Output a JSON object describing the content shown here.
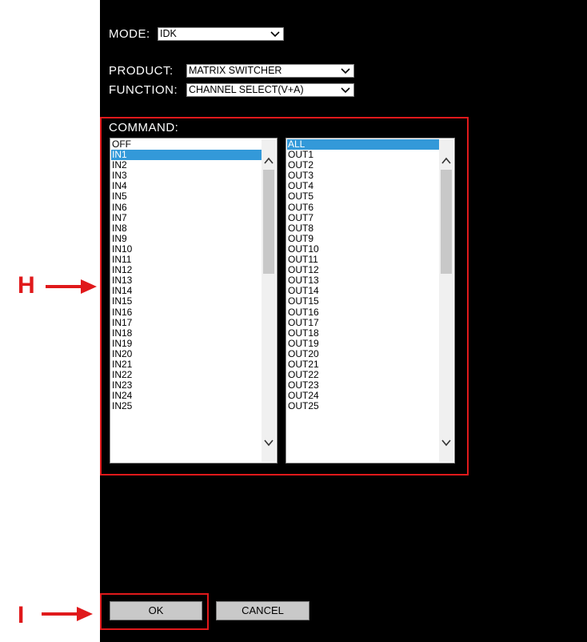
{
  "mode": {
    "label": "MODE:",
    "value": "IDK"
  },
  "product": {
    "label": "PRODUCT:",
    "value": "MATRIX SWITCHER"
  },
  "function": {
    "label": "FUNCTION:",
    "value": "CHANNEL SELECT(V+A)"
  },
  "command": {
    "label": "COMMAND:",
    "inputs": [
      "OFF",
      "IN1",
      "IN2",
      "IN3",
      "IN4",
      "IN5",
      "IN6",
      "IN7",
      "IN8",
      "IN9",
      "IN10",
      "IN11",
      "IN12",
      "IN13",
      "IN14",
      "IN15",
      "IN16",
      "IN17",
      "IN18",
      "IN19",
      "IN20",
      "IN21",
      "IN22",
      "IN23",
      "IN24",
      "IN25"
    ],
    "inputs_selected": "IN1",
    "outputs": [
      "ALL",
      "OUT1",
      "OUT2",
      "OUT3",
      "OUT4",
      "OUT5",
      "OUT6",
      "OUT7",
      "OUT8",
      "OUT9",
      "OUT10",
      "OUT11",
      "OUT12",
      "OUT13",
      "OUT14",
      "OUT15",
      "OUT16",
      "OUT17",
      "OUT18",
      "OUT19",
      "OUT20",
      "OUT21",
      "OUT22",
      "OUT23",
      "OUT24",
      "OUT25"
    ],
    "outputs_selected": "ALL"
  },
  "buttons": {
    "ok": "OK",
    "cancel": "CANCEL"
  },
  "callouts": {
    "h": "H",
    "i": "I"
  },
  "colors": {
    "highlight": "#3399d9",
    "callout_red": "#e0191b",
    "panel": "#000000"
  }
}
